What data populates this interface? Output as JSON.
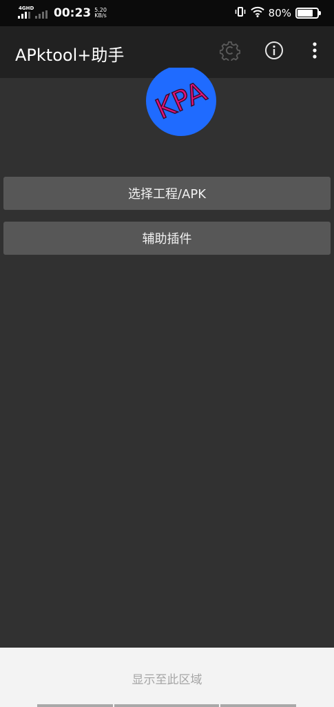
{
  "status_bar": {
    "network": "4GHD",
    "time": "00:23",
    "speed_value": "5.20",
    "speed_unit": "KB/s",
    "battery_percent": "80%",
    "battery_level": 0.8
  },
  "app_bar": {
    "title": "APktool+助手",
    "actions": [
      "gear-icon",
      "info-icon",
      "more-vert-icon"
    ]
  },
  "logo": {
    "text": "KPA",
    "bg_color": "#1f6bff",
    "text_color": "#e0147a"
  },
  "main": {
    "buttons": [
      {
        "label": "选择工程/APK"
      },
      {
        "label": "辅助插件"
      }
    ]
  },
  "bottom_panel": {
    "text": "显示至此区域"
  },
  "colors": {
    "background": "#313131",
    "app_bar": "#212121",
    "status_bar": "#0b0b0b",
    "button": "#575757",
    "bottom_panel": "#f3f3f3"
  }
}
